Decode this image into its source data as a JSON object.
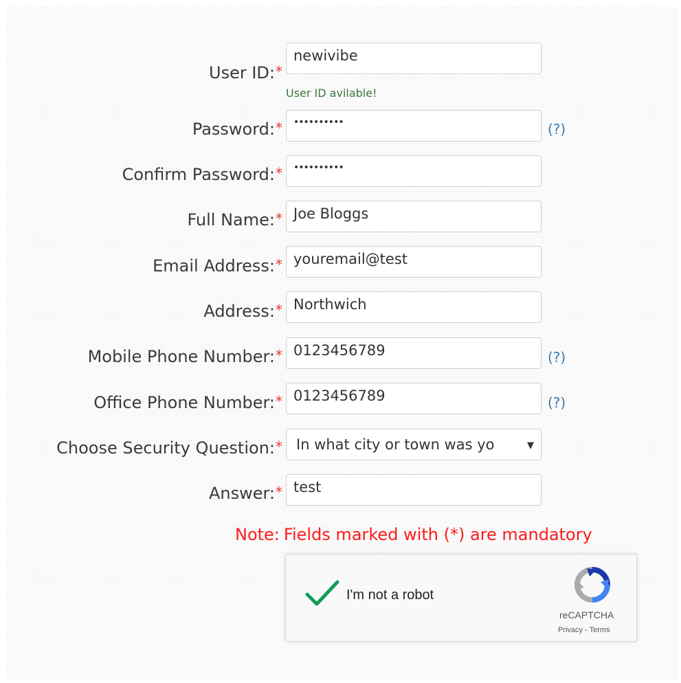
{
  "required_marker": "*",
  "help_text": "(?)",
  "form": {
    "user_id": {
      "label": "User ID:",
      "value": "newivibe",
      "status": "User ID avilable!"
    },
    "password": {
      "label": "Password:",
      "value": "••••••••••"
    },
    "confirm_password": {
      "label": "Confirm Password:",
      "value": "••••••••••"
    },
    "full_name": {
      "label": "Full Name:",
      "value": "Joe Bloggs"
    },
    "email": {
      "label": "Email Address:",
      "value": "youremail@test"
    },
    "address": {
      "label": "Address:",
      "value": "Northwich"
    },
    "mobile_phone": {
      "label": "Mobile Phone Number:",
      "value": "0123456789"
    },
    "office_phone": {
      "label": "Office Phone Number:",
      "value": "0123456789"
    },
    "security_question": {
      "label": "Choose Security Question:",
      "selected": "In what city or town was yo"
    },
    "answer": {
      "label": "Answer:",
      "value": "test"
    }
  },
  "note": {
    "prefix": "Note:",
    "text": "Fields marked with (*) are mandatory"
  },
  "recaptcha": {
    "label": "I'm not a robot",
    "checked": true,
    "brand": "reCAPTCHA",
    "privacy": "Privacy",
    "separator": " - ",
    "terms": "Terms"
  },
  "colors": {
    "required": "#e53935",
    "help_link": "#337ab7",
    "success": "#3c763d",
    "note": "#ff1a1a",
    "check": "#0f9d58"
  },
  "icons": {
    "select_caret": "▼",
    "recaptcha_check": "checkmark-icon",
    "recaptcha_logo": "recaptcha-logo-icon"
  }
}
